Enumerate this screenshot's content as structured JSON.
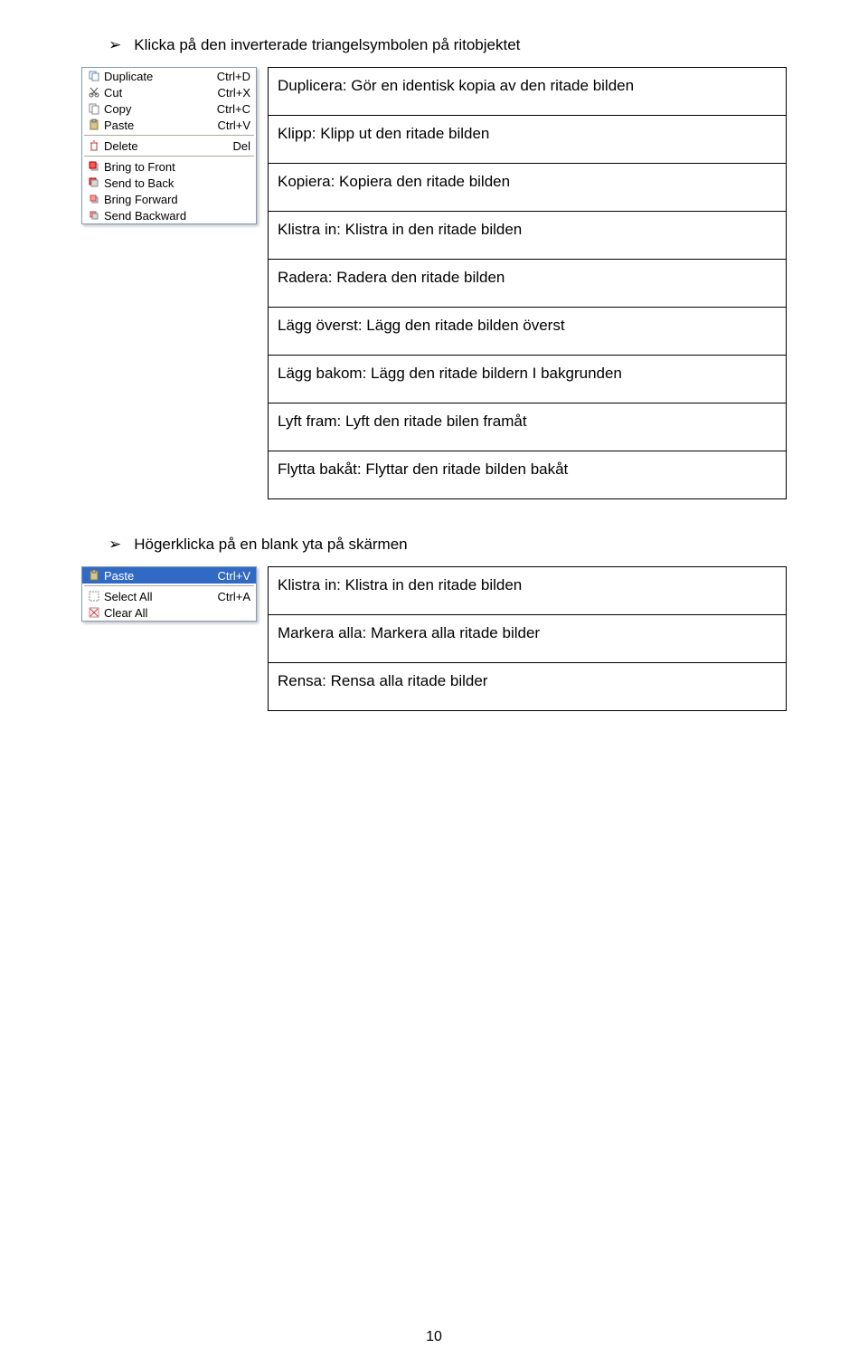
{
  "section1": {
    "heading": "Klicka på den inverterade triangelsymbolen på ritobjektet",
    "menu": {
      "duplicate": {
        "label": "Duplicate",
        "shortcut": "Ctrl+D"
      },
      "cut": {
        "label": "Cut",
        "shortcut": "Ctrl+X"
      },
      "copy": {
        "label": "Copy",
        "shortcut": "Ctrl+C"
      },
      "paste": {
        "label": "Paste",
        "shortcut": "Ctrl+V"
      },
      "delete": {
        "label": "Delete",
        "shortcut": "Del"
      },
      "bringToFront": {
        "label": "Bring to Front"
      },
      "sendToBack": {
        "label": "Send to Back"
      },
      "bringForward": {
        "label": "Bring Forward"
      },
      "sendBackward": {
        "label": "Send Backward"
      }
    },
    "descriptions": {
      "duplicera": "Duplicera: Gör en identisk kopia av den ritade bilden",
      "klipp": "Klipp: Klipp ut den ritade bilden",
      "kopiera": "Kopiera: Kopiera den ritade bilden",
      "klistra": "Klistra in: Klistra in den ritade bilden",
      "radera": "Radera: Radera den ritade bilden",
      "laggOverst": "Lägg överst: Lägg den ritade bilden överst",
      "laggBakom": "Lägg bakom: Lägg den ritade bildern I bakgrunden",
      "lyftFram": "Lyft fram: Lyft den ritade bilen framåt",
      "flyttaBakat": "Flytta bakåt: Flyttar den ritade bilden bakåt"
    }
  },
  "section2": {
    "heading": "Högerklicka på en blank yta på skärmen",
    "menu": {
      "paste": {
        "label": "Paste",
        "shortcut": "Ctrl+V"
      },
      "selectAll": {
        "label": "Select All",
        "shortcut": "Ctrl+A"
      },
      "clearAll": {
        "label": "Clear All"
      }
    },
    "descriptions": {
      "klistra": "Klistra in: Klistra in den ritade bilden",
      "markeraAlla": "Markera alla: Markera alla ritade bilder",
      "rensa": "Rensa: Rensa alla ritade bilder"
    }
  },
  "pageNumber": "10"
}
